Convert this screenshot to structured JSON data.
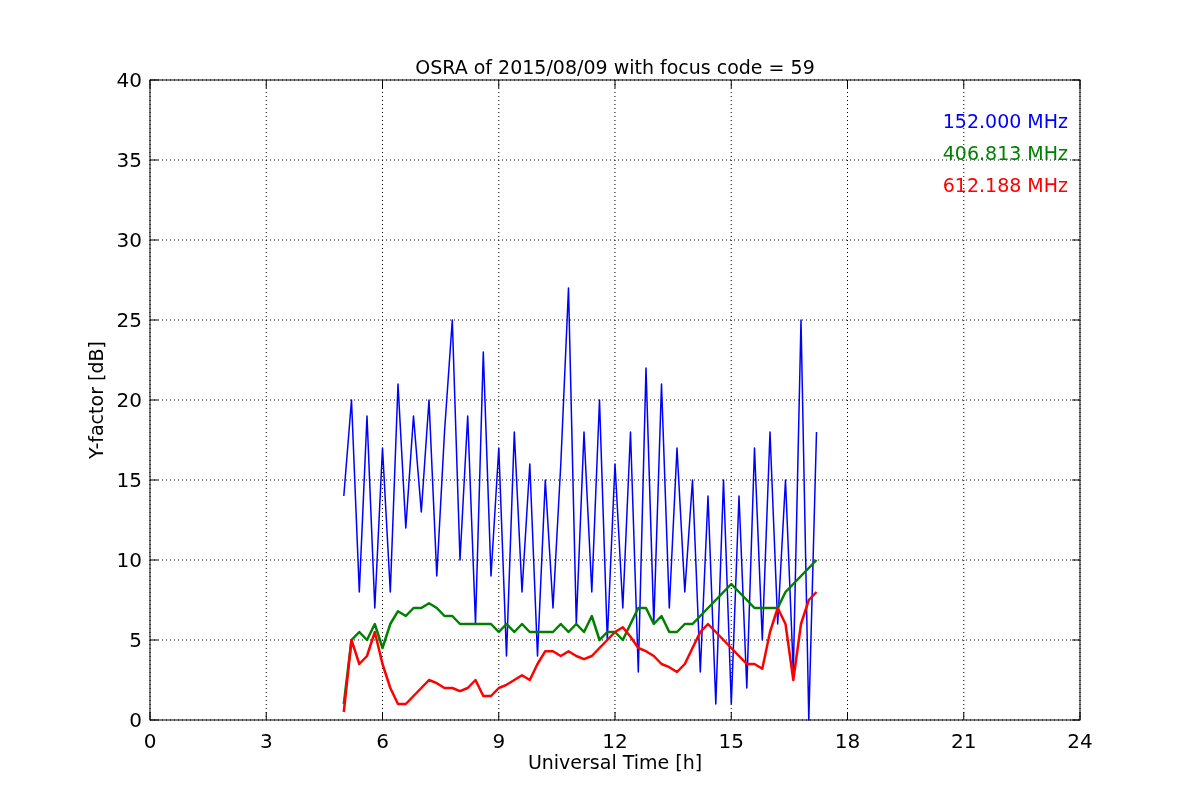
{
  "chart_data": {
    "type": "line",
    "title": "OSRA of 2015/08/09 with focus code = 59",
    "xlabel": "Universal Time [h]",
    "ylabel": "Y-factor [dB]",
    "x": [
      5,
      5.2,
      5.4,
      5.6,
      5.8,
      6,
      6.2,
      6.4,
      6.6,
      6.8,
      7,
      7.2,
      7.4,
      7.6,
      7.8,
      8,
      8.2,
      8.4,
      8.6,
      8.8,
      9,
      9.2,
      9.4,
      9.6,
      9.8,
      10,
      10.2,
      10.4,
      10.6,
      10.8,
      11,
      11.2,
      11.4,
      11.6,
      11.8,
      12,
      12.2,
      12.4,
      12.6,
      12.8,
      13,
      13.2,
      13.4,
      13.6,
      13.8,
      14,
      14.2,
      14.4,
      14.6,
      14.8,
      15,
      15.2,
      15.4,
      15.6,
      15.8,
      16,
      16.2,
      16.4,
      16.6,
      16.8,
      17,
      17.2
    ],
    "series": [
      {
        "name": "152.000 MHz",
        "color": "#0000ff",
        "values": [
          14,
          20,
          8,
          19,
          7,
          17,
          8,
          21,
          12,
          19,
          13,
          20,
          9,
          18,
          25,
          10,
          19,
          6,
          23,
          9,
          17,
          4,
          18,
          8,
          16,
          4,
          15,
          7,
          16,
          27,
          6,
          18,
          8,
          20,
          5,
          16,
          7,
          18,
          3,
          22,
          6,
          21,
          7,
          17,
          8,
          15,
          3,
          14,
          1,
          15,
          1,
          14,
          2,
          17,
          5,
          18,
          6,
          15,
          3,
          25,
          0,
          18
        ]
      },
      {
        "name": "406.813 MHz",
        "color": "#008000",
        "values": [
          1,
          5,
          5.5,
          5,
          6,
          4.5,
          6,
          6.8,
          6.5,
          7,
          7,
          7.3,
          7,
          6.5,
          6.5,
          6,
          6,
          6,
          6,
          6,
          5.5,
          6,
          5.5,
          6,
          5.5,
          5.5,
          5.5,
          5.5,
          6,
          5.5,
          6,
          5.5,
          6.5,
          5,
          5.5,
          5.5,
          5,
          6,
          7,
          7,
          6,
          6.5,
          5.5,
          5.5,
          6,
          6,
          6.5,
          7,
          7.5,
          8,
          8.5,
          8,
          7.5,
          7,
          7,
          7,
          7,
          8,
          8.5,
          9,
          9.5,
          10
        ]
      },
      {
        "name": "612.188 MHz",
        "color": "#ff0000",
        "values": [
          0.5,
          5,
          3.5,
          4,
          5.5,
          3.5,
          2,
          1,
          1,
          1.5,
          2,
          2.5,
          2.3,
          2,
          2,
          1.8,
          2,
          2.5,
          1.5,
          1.5,
          2,
          2.2,
          2.5,
          2.8,
          2.5,
          3.5,
          4.3,
          4.3,
          4,
          4.3,
          4,
          3.8,
          4,
          4.5,
          5,
          5.5,
          5.8,
          5.2,
          4.5,
          4.3,
          4,
          3.5,
          3.3,
          3,
          3.5,
          4.5,
          5.5,
          6,
          5.5,
          5,
          4.5,
          4,
          3.5,
          3.5,
          3.2,
          5.5,
          7,
          6,
          2.5,
          6,
          7.5,
          8
        ]
      }
    ],
    "grid": true,
    "xlim": [
      0,
      24
    ],
    "ylim": [
      0,
      40
    ],
    "xticks": [
      0,
      3,
      6,
      9,
      12,
      15,
      18,
      21,
      24
    ],
    "yticks": [
      0,
      5,
      10,
      15,
      20,
      25,
      30,
      35,
      40
    ]
  }
}
